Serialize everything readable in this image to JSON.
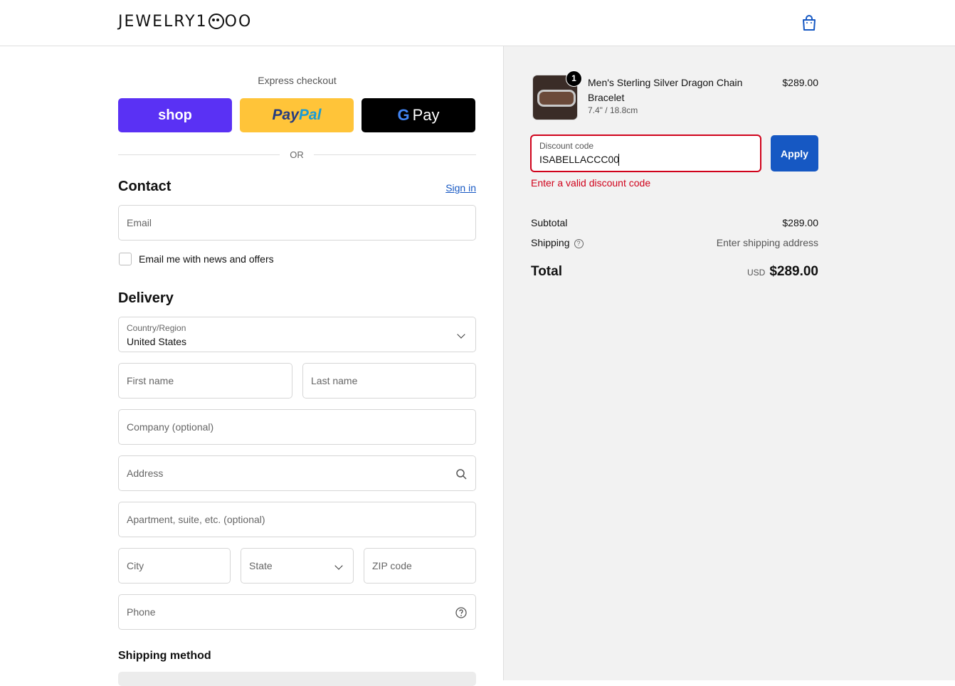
{
  "header": {
    "logo_left": "JEWELRY1",
    "logo_right": "OO",
    "cart_icon": "shopping-bag-icon"
  },
  "express": {
    "label": "Express checkout",
    "shop_label": "shop",
    "paypal_a": "Pay",
    "paypal_b": "Pal",
    "gpay_g": "G",
    "gpay_label": "Pay",
    "or": "OR"
  },
  "contact": {
    "heading": "Contact",
    "signin": "Sign in",
    "email_placeholder": "Email",
    "newsletter_label": "Email me with news and offers"
  },
  "delivery": {
    "heading": "Delivery",
    "country_label": "Country/Region",
    "country_value": "United States",
    "first_name": "First name",
    "last_name": "Last name",
    "company": "Company (optional)",
    "address": "Address",
    "apartment": "Apartment, suite, etc. (optional)",
    "city": "City",
    "state": "State",
    "zip": "ZIP code",
    "phone": "Phone"
  },
  "shipping_method": {
    "heading": "Shipping method"
  },
  "summary": {
    "product": {
      "quantity": "1",
      "name": "Men's Sterling Silver Dragon Chain Bracelet",
      "variant": "7.4\" / 18.8cm",
      "price": "$289.00"
    },
    "discount": {
      "label": "Discount code",
      "value": "ISABELLACCC00",
      "apply": "Apply",
      "error": "Enter a valid discount code"
    },
    "subtotal_label": "Subtotal",
    "subtotal_value": "$289.00",
    "shipping_label": "Shipping",
    "shipping_help": "?",
    "shipping_value": "Enter shipping address",
    "total_label": "Total",
    "currency": "USD",
    "total_value": "$289.00"
  },
  "colors": {
    "shop_brand": "#5a31f4",
    "paypal_brand": "#ffc439",
    "accent_blue": "#1658c3",
    "error_red": "#d0021b"
  }
}
